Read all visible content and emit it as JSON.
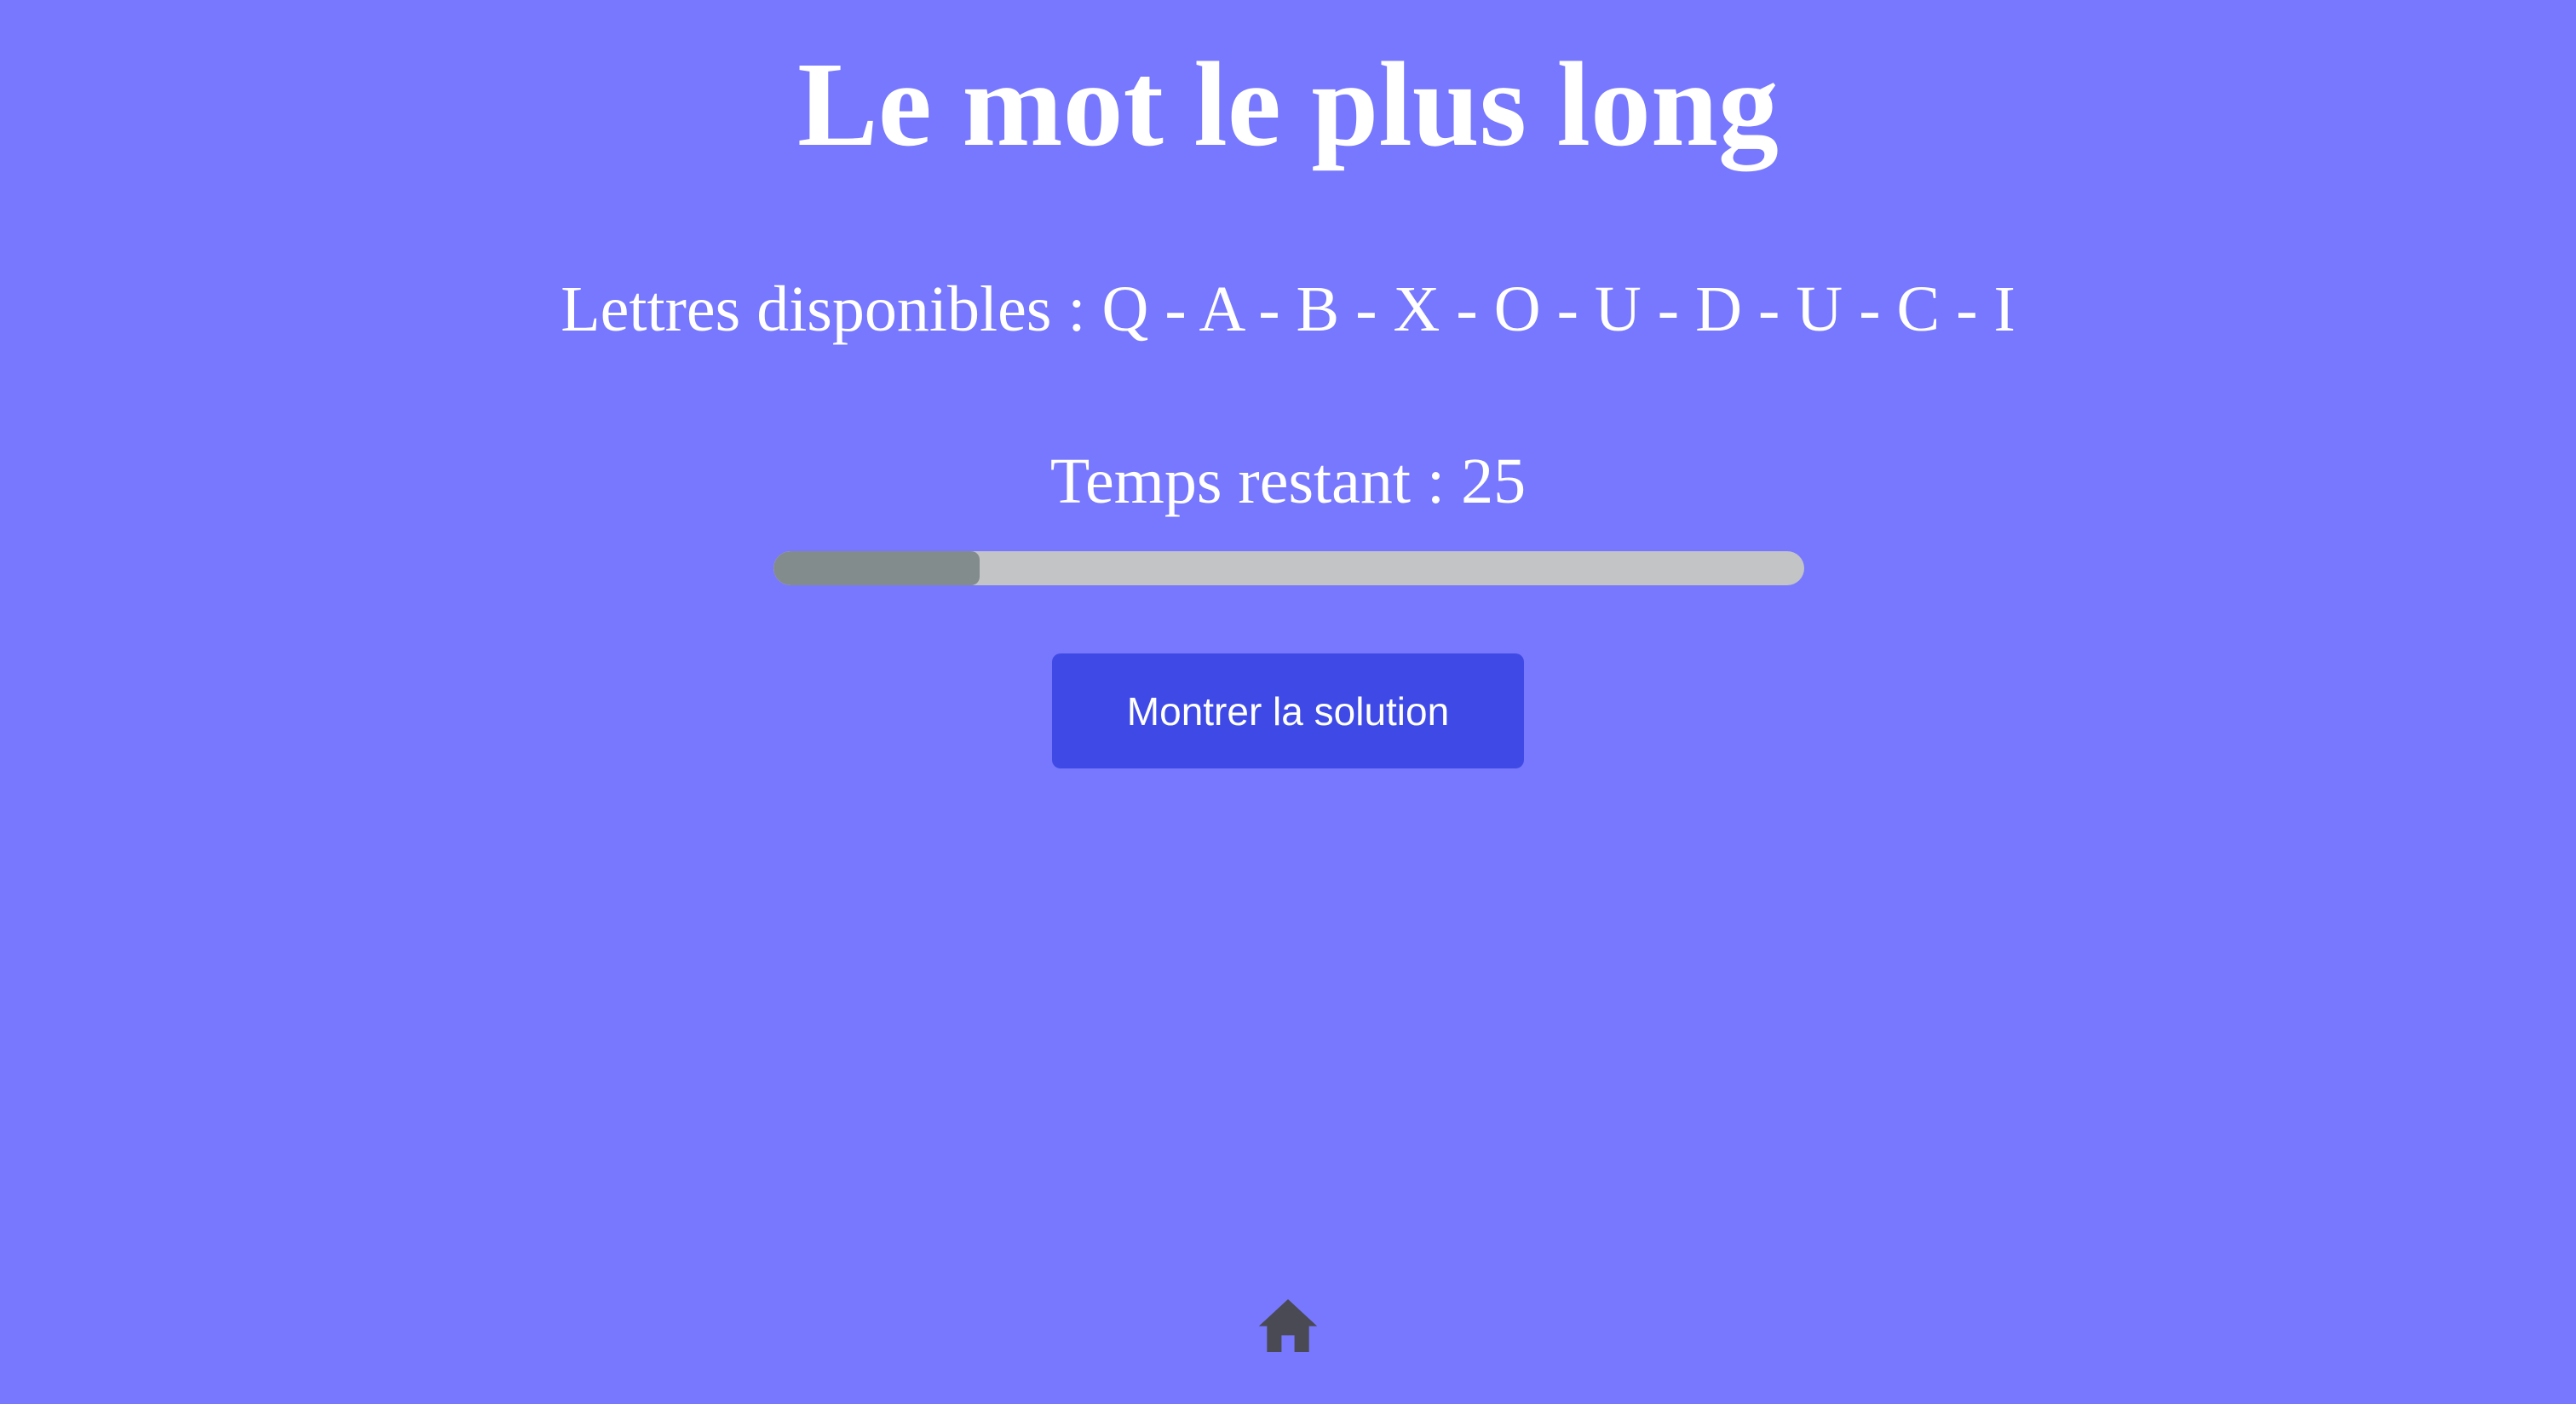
{
  "header": {
    "title": "Le mot le plus long"
  },
  "game": {
    "letters_text": "Lettres disponibles : Q - A - B - X - O - U - D - U - C - I",
    "letters": [
      "Q",
      "A",
      "B",
      "X",
      "O",
      "U",
      "D",
      "U",
      "C",
      "I"
    ],
    "timer_text": "Temps restant : 25",
    "time_remaining": 25,
    "progress_fraction": 0.2
  },
  "actions": {
    "show_solution_label": "Montrer la solution"
  },
  "footer": {
    "home_icon": "home-icon"
  },
  "colors": {
    "background": "#7878fe",
    "button": "#3f4ae6",
    "progress_track": "#c2c4c6",
    "progress_fill": "#838c8c",
    "home_icon": "#4a4a55"
  }
}
